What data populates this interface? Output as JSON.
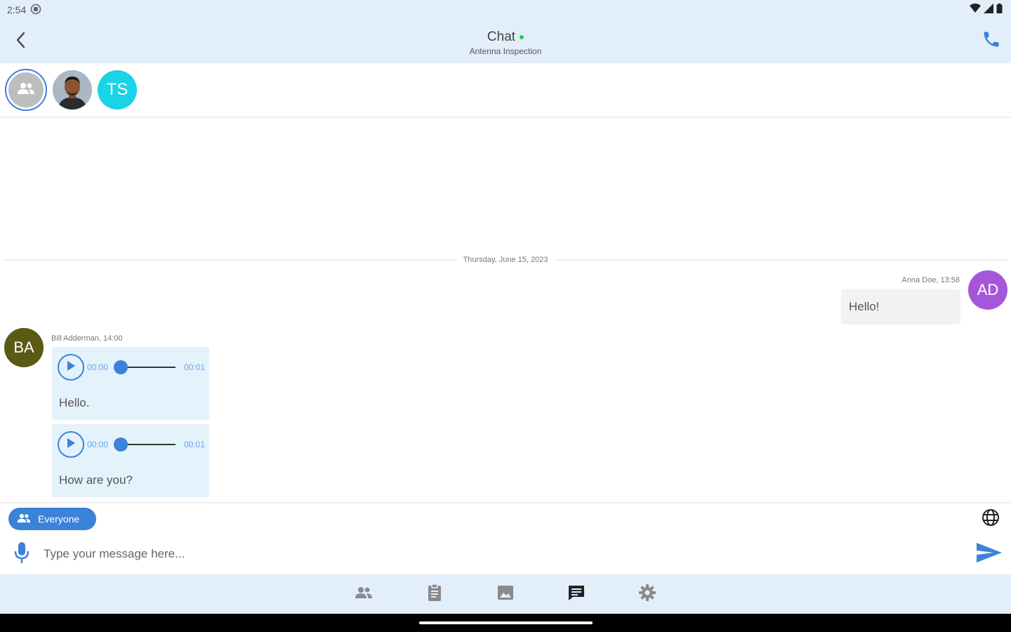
{
  "status_bar": {
    "time": "2:54"
  },
  "header": {
    "title": "Chat",
    "subtitle": "Antenna Inspection"
  },
  "participants": [
    {
      "type": "group",
      "icon": "group-icon"
    },
    {
      "type": "photo"
    },
    {
      "type": "initials",
      "initials": "TS",
      "color": "#19d3e6"
    }
  ],
  "conversation": {
    "date_separator": "Thursday, June 15, 2023",
    "outgoing": {
      "meta": "Anna Doe, 13:58",
      "text": "Hello!",
      "avatar_initials": "AD",
      "avatar_color": "#a657d9"
    },
    "incoming": {
      "meta": "Bill Adderman, 14:00",
      "avatar_initials": "BA",
      "avatar_color": "#5a5a14",
      "messages": [
        {
          "current_time": "00:00",
          "duration": "00:01",
          "text": "Hello."
        },
        {
          "current_time": "00:00",
          "duration": "00:01",
          "text": "How are you?"
        }
      ]
    }
  },
  "composer": {
    "recipient_chip": "Everyone",
    "placeholder": "Type your message here..."
  },
  "bottom_nav": [
    {
      "name": "participants",
      "icon": "people-icon",
      "active": false
    },
    {
      "name": "tasks",
      "icon": "clipboard-icon",
      "active": false
    },
    {
      "name": "gallery",
      "icon": "image-icon",
      "active": false
    },
    {
      "name": "chat",
      "icon": "chat-icon",
      "active": true
    },
    {
      "name": "settings",
      "icon": "gear-icon",
      "active": false
    }
  ],
  "colors": {
    "accent": "#3b82d9",
    "header_bg": "#e3eefb",
    "incoming_bubble": "#e4f2fc",
    "outgoing_bubble": "#f2f2f2"
  }
}
